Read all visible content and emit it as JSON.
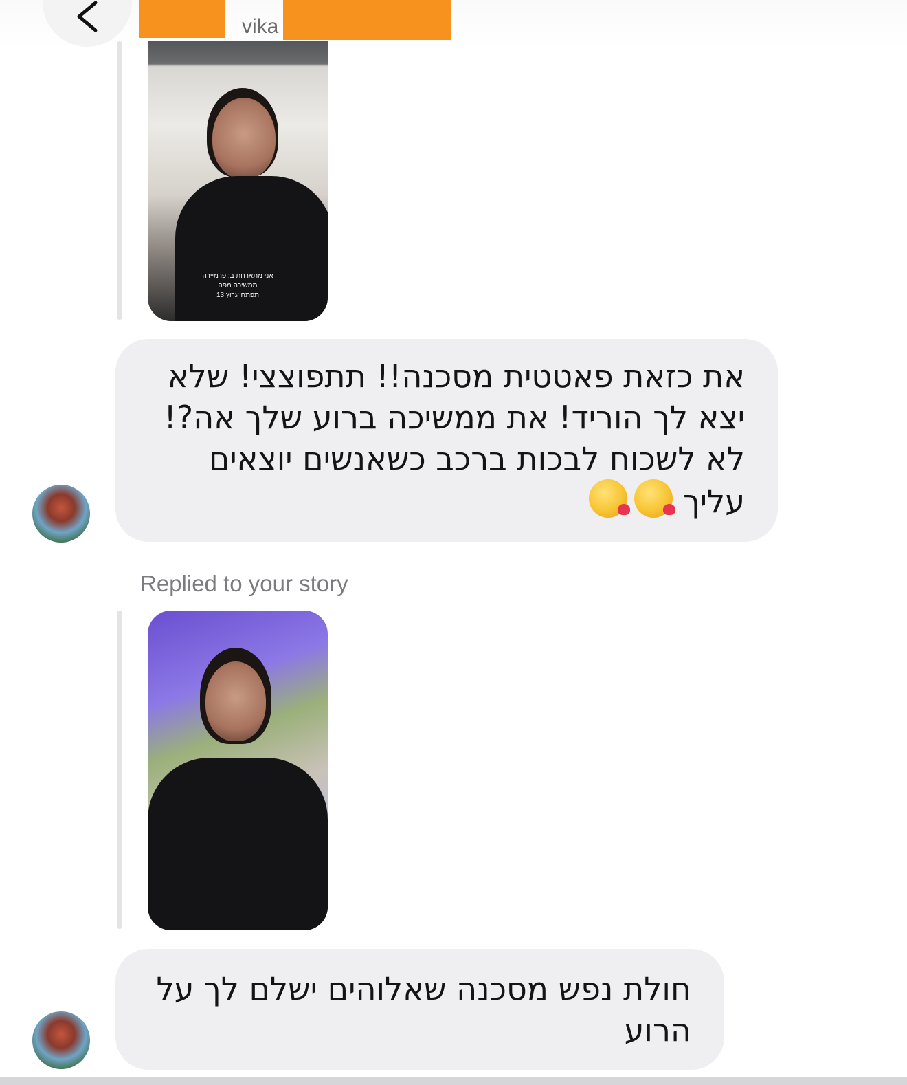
{
  "header": {
    "username": "vika",
    "back_icon": "chevron-left-icon"
  },
  "messages": [
    {
      "type": "story_reply",
      "story_caption_lines": [
        "אני מתארחת ב: פרמיירה",
        "ממשיכה מפה",
        "תפתח ערוץ 13"
      ]
    },
    {
      "type": "text",
      "text": "את כזאת פאטטית מסכנה!! תתפוצצי! שלא יצא לך הוריד! את ממשיכה ברוע שלך אה?! לא לשכוח לבכות ברכב כשאנשים יוצאים עליך",
      "emojis": [
        "kissing-face-with-heart-emoji",
        "kissing-face-with-heart-emoji"
      ]
    },
    {
      "type": "story_reply",
      "label": "Replied to your story"
    },
    {
      "type": "text",
      "text": "חולת נפש מסכנה שאלוהים ישלם לך על הרוע"
    }
  ],
  "colors": {
    "redaction": "#f7921e",
    "bubble_bg": "#efeff2",
    "label_gray": "#7c7c80"
  }
}
